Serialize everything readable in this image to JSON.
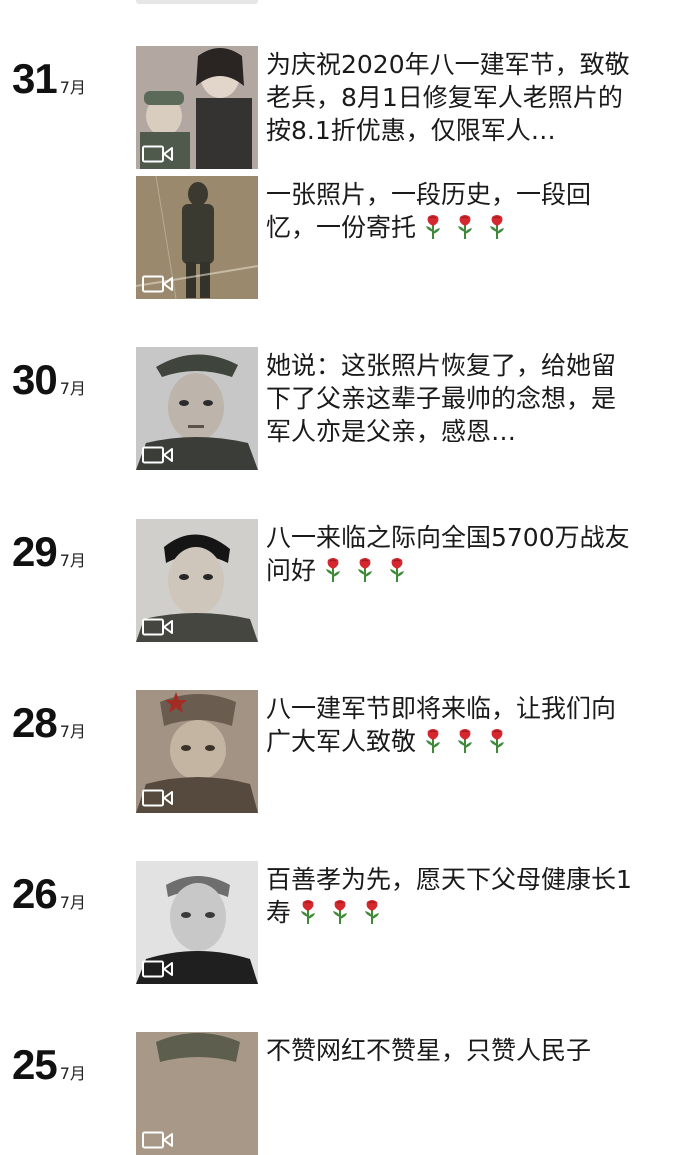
{
  "posts": [
    {
      "day": "31",
      "month": "7月",
      "items": [
        {
          "text": "为庆祝2020年八一建军节，致敬老兵，8月1日修复军人老照片的按8.1折优惠，仅限军人…",
          "roses": 0,
          "photo": "couple-sepia"
        },
        {
          "text": "一张照片，一段历史，一段回忆，一份寄托",
          "roses": 3,
          "photo": "standing-soldier"
        }
      ]
    },
    {
      "day": "30",
      "month": "7月",
      "items": [
        {
          "text": "她说：这张照片恢复了，给她留下了父亲这辈子最帅的念想，是军人亦是父亲，感恩…",
          "roses": 0,
          "photo": "soldier-cap-portrait"
        }
      ]
    },
    {
      "day": "29",
      "month": "7月",
      "items": [
        {
          "text": "八一来临之际向全国5700万战友问好",
          "roses": 3,
          "photo": "young-man-portrait"
        }
      ]
    },
    {
      "day": "28",
      "month": "7月",
      "items": [
        {
          "text": "八一建军节即将来临，让我们向广大军人致敬",
          "roses": 3,
          "photo": "soldier-star-cap-sepia"
        }
      ]
    },
    {
      "day": "26",
      "month": "7月",
      "items": [
        {
          "text": "百善孝为先，愿天下父母健康长1寿",
          "roses": 3,
          "photo": "elder-portrait-bw"
        }
      ]
    },
    {
      "day": "25",
      "month": "7月",
      "items": [
        {
          "text": "不赞网红不赞星，只赞人民子",
          "roses": 0,
          "photo": "soldier-partial"
        }
      ]
    }
  ],
  "icons": {
    "video": "video-camera-icon",
    "rose": "rose-emoji-icon"
  },
  "colors": {
    "background": "#ffffff",
    "text": "#1a1a1a",
    "rose": "#d4282e",
    "stem": "#3e8a3a"
  }
}
